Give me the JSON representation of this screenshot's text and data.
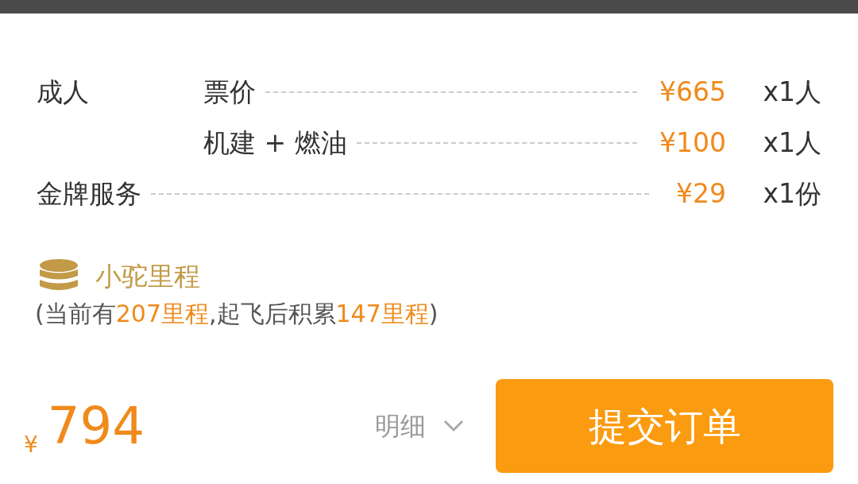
{
  "fees": [
    {
      "kind": "sub",
      "group": "成人",
      "label": "票价",
      "price": "¥665",
      "qty": "x1人"
    },
    {
      "kind": "sub",
      "label": "机建 + 燃油",
      "price": "¥100",
      "qty": "x1人"
    },
    {
      "kind": "main",
      "label": "金牌服务",
      "price": "¥29",
      "qty": "x1份"
    }
  ],
  "mileage": {
    "title": "小驼里程",
    "note": [
      {
        "text": "(当前有",
        "highlight": false
      },
      {
        "text": "207里程",
        "highlight": true
      },
      {
        "text": ",起飞后积累",
        "highlight": false
      },
      {
        "text": "147里程",
        "highlight": true
      },
      {
        "text": ")",
        "highlight": false
      }
    ]
  },
  "footer": {
    "currency": "¥",
    "total": "794",
    "details": "明细",
    "submit": "提交订单"
  }
}
